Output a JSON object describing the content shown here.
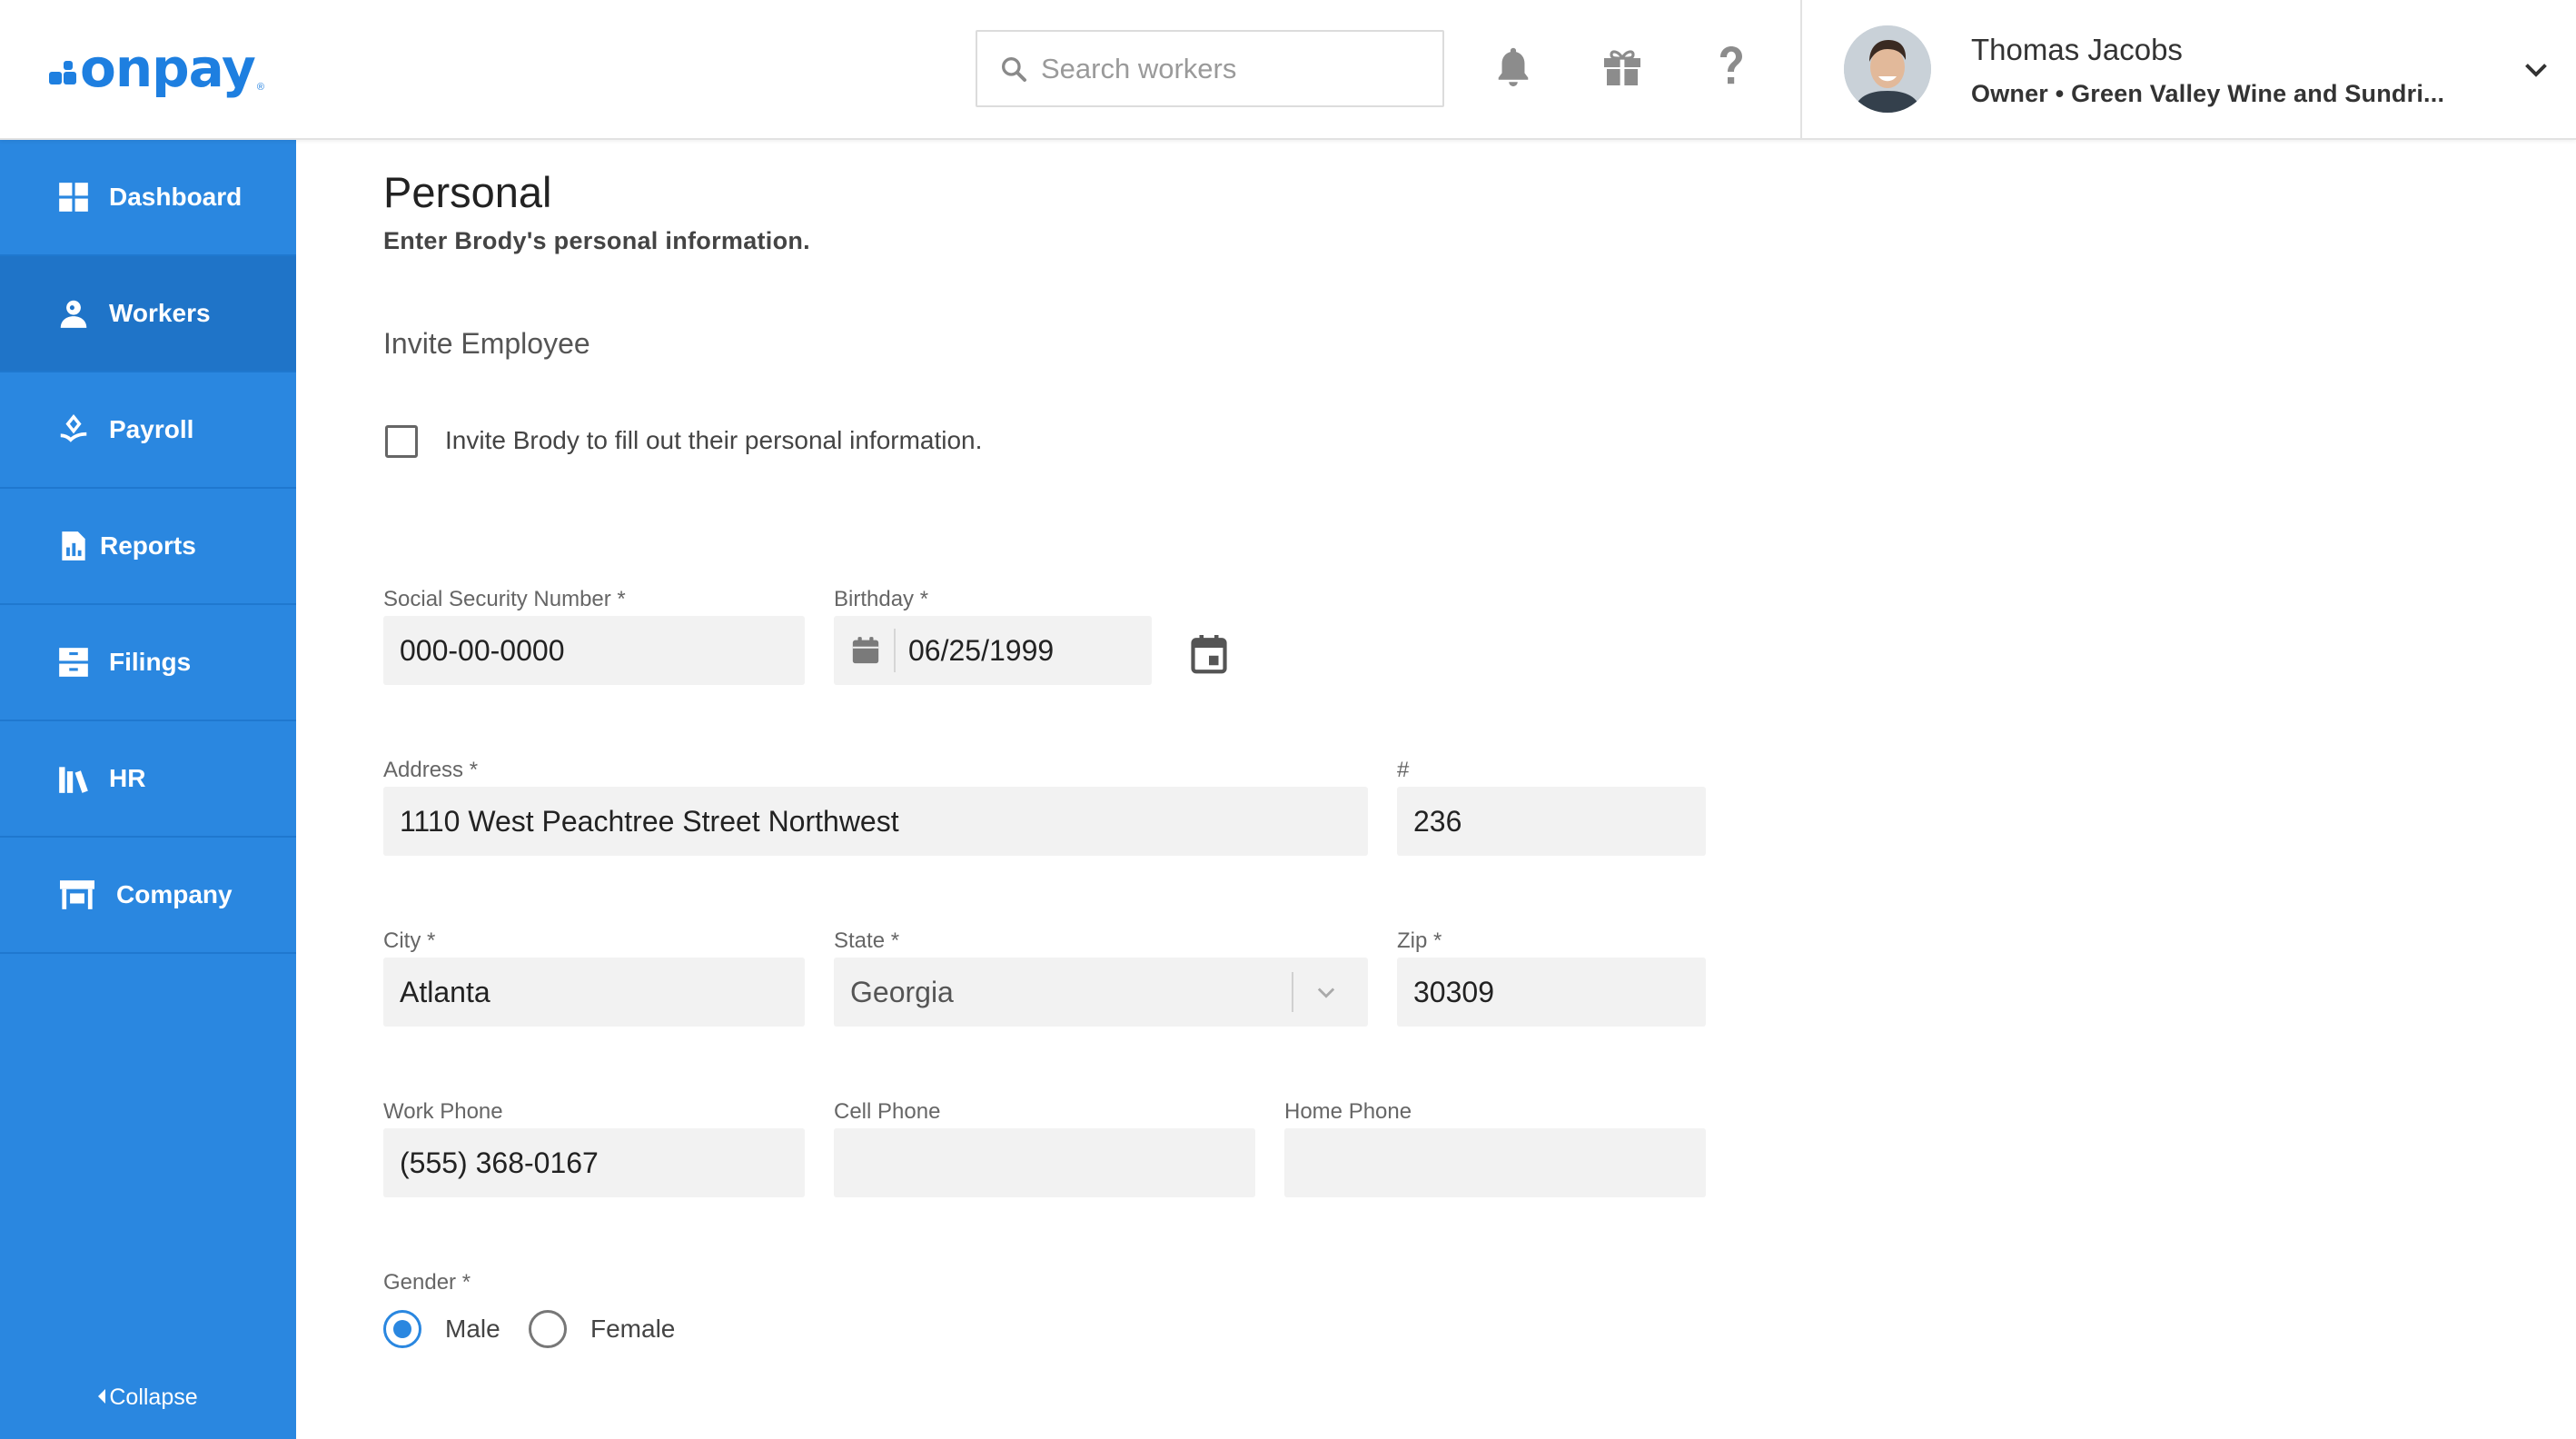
{
  "brand": {
    "name": "onpay",
    "color": "#1e7fe0",
    "registered": "®"
  },
  "header": {
    "search_placeholder": "Search workers",
    "icons": [
      "bell-icon",
      "gift-icon",
      "help-icon"
    ],
    "user": {
      "name": "Thomas Jacobs",
      "role": "Owner • Green Valley Wine and Sundri..."
    }
  },
  "sidebar": {
    "color": "#2a87e0",
    "items": [
      {
        "label": "Dashboard",
        "icon": "dashboard-icon"
      },
      {
        "label": "Workers",
        "icon": "workers-icon",
        "active": true
      },
      {
        "label": "Payroll",
        "icon": "payroll-icon"
      },
      {
        "label": "Reports",
        "icon": "reports-icon"
      },
      {
        "label": "Filings",
        "icon": "filings-icon"
      },
      {
        "label": "HR",
        "icon": "hr-icon"
      },
      {
        "label": "Company",
        "icon": "company-icon"
      }
    ],
    "collapse_label": "Collapse"
  },
  "page": {
    "title": "Personal",
    "subtitle": "Enter Brody's personal information.",
    "invite": {
      "section_title": "Invite Employee",
      "checkbox_label": "Invite Brody to fill out their personal information.",
      "checked": false
    },
    "fields": {
      "ssn": {
        "label": "Social Security Number *",
        "value": "000-00-0000"
      },
      "birthday": {
        "label": "Birthday *",
        "value": "06/25/1999"
      },
      "address": {
        "label": "Address *",
        "value": "1110 West Peachtree Street Northwest"
      },
      "unit": {
        "label": "#",
        "value": "236"
      },
      "city": {
        "label": "City *",
        "value": "Atlanta"
      },
      "state": {
        "label": "State *",
        "value": "Georgia"
      },
      "zip": {
        "label": "Zip *",
        "value": "30309"
      },
      "work_phone": {
        "label": "Work Phone",
        "value": "(555) 368-0167"
      },
      "cell_phone": {
        "label": "Cell Phone",
        "value": ""
      },
      "home_phone": {
        "label": "Home Phone",
        "value": ""
      }
    },
    "gender": {
      "label": "Gender *",
      "options": [
        "Male",
        "Female"
      ],
      "selected": "Male"
    }
  }
}
